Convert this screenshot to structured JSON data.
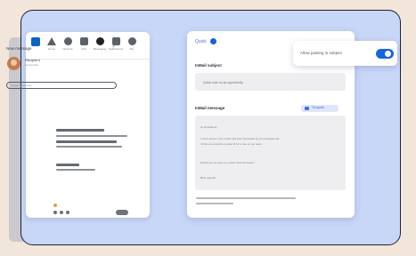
{
  "phone": {
    "nav": [
      {
        "icon": "linkedin-logo-icon",
        "label": ""
      },
      {
        "icon": "home-icon",
        "label": "Home"
      },
      {
        "icon": "network-icon",
        "label": "Network"
      },
      {
        "icon": "jobs-icon",
        "label": "Jobs"
      },
      {
        "icon": "messaging-icon",
        "label": "Messaging"
      },
      {
        "icon": "notifications-icon",
        "label": "Notifications"
      },
      {
        "icon": "me-icon",
        "label": "Me"
      }
    ],
    "compose_title": "New message",
    "close_glyph": "×",
    "recipient_name": "Recipient",
    "recipient_meta": "Connection",
    "subject_placeholder": "Subject (optional)",
    "footer_left": "",
    "footer_right": ""
  },
  "panel": {
    "tab_label": "Quick",
    "toggle_label": "Allow pasting in subject",
    "toggle_on": true,
    "subject_title": "InMail subject",
    "subject_value": "Quick note on an opportunity",
    "message_title": "InMail message",
    "tag_label": "Template",
    "message_lines": [
      "Hi {firstName},",
      "",
      "I came across your profile and was impressed by your background.",
      "I think you could be a great fit for a role on our team.",
      "",
      "Would you be open to a short chat this week?",
      "",
      "Best regards"
    ],
    "note_lines": [
      "",
      ""
    ]
  },
  "colors": {
    "accent": "#1565e0",
    "frame_bg": "#c8d6f7",
    "page_bg": "#f2e6da"
  }
}
